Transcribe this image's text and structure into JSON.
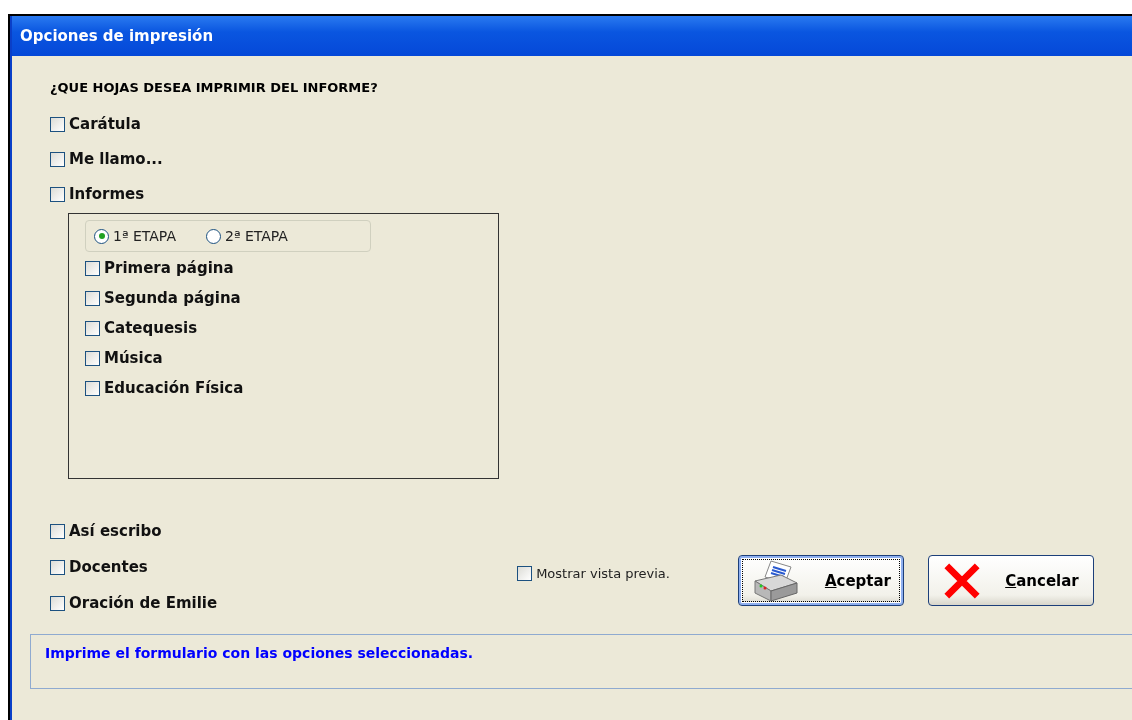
{
  "window": {
    "title": "Opciones de impresión"
  },
  "question": "¿QUE HOJAS DESEA IMPRIMIR DEL INFORME?",
  "top_options": [
    {
      "label": "Carátula",
      "checked": false
    },
    {
      "label": "Me llamo...",
      "checked": false
    },
    {
      "label": "Informes",
      "checked": false
    }
  ],
  "stages": [
    {
      "label": "1ª ETAPA",
      "selected": true
    },
    {
      "label": "2ª ETAPA",
      "selected": false
    }
  ],
  "report_options": [
    {
      "label": "Primera página",
      "checked": false
    },
    {
      "label": "Segunda página",
      "checked": false
    },
    {
      "label": "Catequesis",
      "checked": false
    },
    {
      "label": "Música",
      "checked": false
    },
    {
      "label": "Educación Física",
      "checked": false
    }
  ],
  "bottom_options": [
    {
      "label": "Así escribo",
      "checked": false
    },
    {
      "label": "Docentes",
      "checked": false
    },
    {
      "label": "Oración de Emilie",
      "checked": false
    }
  ],
  "preview": {
    "label": "Mostrar vista previa.",
    "checked": false
  },
  "buttons": [
    {
      "kind": "print",
      "label": "Aceptar",
      "focused": true
    },
    {
      "kind": "cancel",
      "label": "Cancelar",
      "focused": false
    }
  ],
  "status": "Imprime el formulario con las opciones seleccionadas."
}
